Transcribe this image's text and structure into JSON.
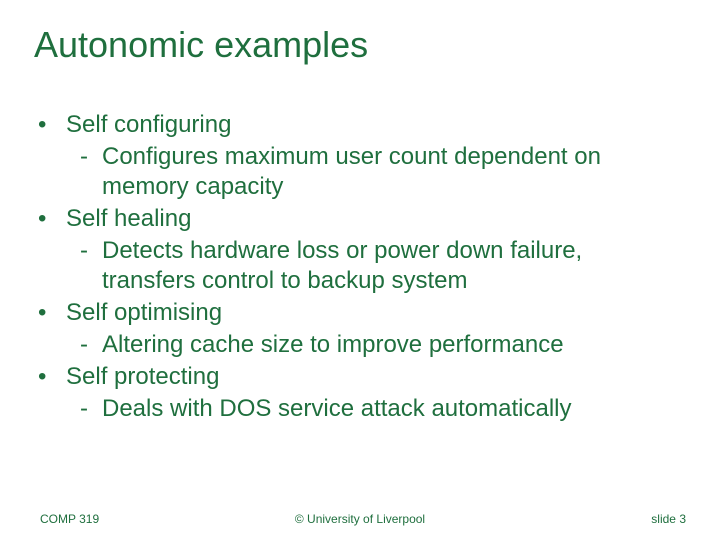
{
  "title": "Autonomic examples",
  "bullets": [
    {
      "text": "Self configuring",
      "sub": "Configures maximum user count dependent on memory capacity"
    },
    {
      "text": "Self healing",
      "sub": "Detects hardware loss or power down failure, transfers control to backup system"
    },
    {
      "text": "Self optimising",
      "sub": "Altering cache size to improve performance"
    },
    {
      "text": "Self protecting",
      "sub": "Deals with DOS service attack automatically"
    }
  ],
  "footer": {
    "left": "COMP 319",
    "center": "© University of Liverpool",
    "right_prefix": "slide ",
    "right_num": "3"
  }
}
